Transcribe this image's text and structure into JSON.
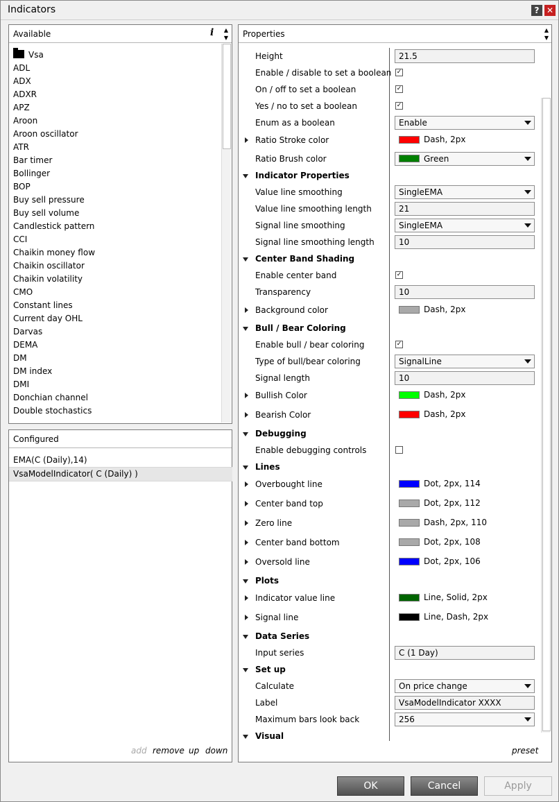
{
  "window": {
    "title": "Indicators",
    "help": "?",
    "close": "✕"
  },
  "available": {
    "title": "Available",
    "info": "i",
    "items": [
      "Vsa",
      "ADL",
      "ADX",
      "ADXR",
      "APZ",
      "Aroon",
      "Aroon oscillator",
      "ATR",
      "Bar timer",
      "Bollinger",
      "BOP",
      "Buy sell pressure",
      "Buy sell volume",
      "Candlestick pattern",
      "CCI",
      "Chaikin money flow",
      "Chaikin oscillator",
      "Chaikin volatility",
      "CMO",
      "Constant lines",
      "Current day OHL",
      "Darvas",
      "DEMA",
      "DM",
      "DM index",
      "DMI",
      "Donchian channel",
      "Double stochastics"
    ]
  },
  "configured": {
    "title": "Configured",
    "items": [
      "EMA(C (Daily),14)",
      "VsaModelIndicator( C (Daily) )"
    ],
    "add": "add",
    "remove": "remove",
    "up": "up",
    "down": "down"
  },
  "properties": {
    "title": "Properties",
    "preset": "preset",
    "rows": [
      {
        "kind": "text",
        "name": "Height",
        "value": "21.5"
      },
      {
        "kind": "check",
        "name": "Enable / disable to set a boolean",
        "checked": true
      },
      {
        "kind": "check",
        "name": "On / off to set a boolean",
        "checked": true
      },
      {
        "kind": "check",
        "name": "Yes / no to set a boolean",
        "checked": true
      },
      {
        "kind": "dd",
        "name": "Enum as a boolean",
        "value": "Enable"
      },
      {
        "kind": "color",
        "name": "Ratio Stroke color",
        "color": "#ff0000",
        "value": "Dash, 2px",
        "expand": true
      },
      {
        "kind": "ddcolor",
        "name": "Ratio Brush color",
        "color": "#008000",
        "value": "Green"
      },
      {
        "kind": "cat",
        "name": "Indicator Properties"
      },
      {
        "kind": "dd",
        "name": "Value line smoothing",
        "value": "SingleEMA"
      },
      {
        "kind": "text",
        "name": "Value line smoothing length",
        "value": "21"
      },
      {
        "kind": "dd",
        "name": "Signal line smoothing",
        "value": "SingleEMA"
      },
      {
        "kind": "text",
        "name": "Signal line smoothing length",
        "value": "10"
      },
      {
        "kind": "cat",
        "name": "Center Band Shading"
      },
      {
        "kind": "check",
        "name": "Enable center band",
        "checked": true
      },
      {
        "kind": "text",
        "name": "Transparency",
        "value": "10"
      },
      {
        "kind": "color",
        "name": "Background color",
        "color": "#a9a9a9",
        "value": "Dash, 2px",
        "expand": true
      },
      {
        "kind": "cat",
        "name": "Bull / Bear Coloring"
      },
      {
        "kind": "check",
        "name": "Enable bull / bear coloring",
        "checked": true
      },
      {
        "kind": "dd",
        "name": "Type of bull/bear coloring",
        "value": "SignalLine"
      },
      {
        "kind": "text",
        "name": "Signal length",
        "value": "10"
      },
      {
        "kind": "color",
        "name": "Bullish Color",
        "color": "#00ff00",
        "value": "Dash, 2px",
        "expand": true
      },
      {
        "kind": "color",
        "name": "Bearish Color",
        "color": "#ff0000",
        "value": "Dash, 2px",
        "expand": true
      },
      {
        "kind": "cat",
        "name": "Debugging"
      },
      {
        "kind": "check",
        "name": "Enable debugging controls",
        "checked": false
      },
      {
        "kind": "cat",
        "name": "Lines"
      },
      {
        "kind": "color",
        "name": "Overbought line",
        "color": "#0000ff",
        "value": "Dot, 2px, 114",
        "expand": true
      },
      {
        "kind": "color",
        "name": "Center band top",
        "color": "#a9a9a9",
        "value": "Dot, 2px, 112",
        "expand": true
      },
      {
        "kind": "color",
        "name": "Zero line",
        "color": "#a9a9a9",
        "value": "Dash, 2px, 110",
        "expand": true
      },
      {
        "kind": "color",
        "name": "Center band bottom",
        "color": "#a9a9a9",
        "value": "Dot, 2px, 108",
        "expand": true
      },
      {
        "kind": "color",
        "name": "Oversold line",
        "color": "#0000ff",
        "value": "Dot, 2px, 106",
        "expand": true
      },
      {
        "kind": "cat",
        "name": "Plots"
      },
      {
        "kind": "color",
        "name": "Indicator value line",
        "color": "#006400",
        "value": "Line, Solid, 2px",
        "expand": true
      },
      {
        "kind": "color",
        "name": "Signal line",
        "color": "#000000",
        "value": "Line, Dash, 2px",
        "expand": true
      },
      {
        "kind": "cat",
        "name": "Data Series"
      },
      {
        "kind": "text",
        "name": "Input series",
        "value": "C (1 Day)"
      },
      {
        "kind": "cat",
        "name": "Set up"
      },
      {
        "kind": "dd",
        "name": "Calculate",
        "value": "On price change"
      },
      {
        "kind": "text",
        "name": "Label",
        "value": "VsaModelIndicator XXXX"
      },
      {
        "kind": "dd",
        "name": "Maximum bars look back",
        "value": "256"
      },
      {
        "kind": "cat",
        "name": "Visual"
      }
    ]
  },
  "buttons": {
    "ok": "OK",
    "cancel": "Cancel",
    "apply": "Apply"
  }
}
